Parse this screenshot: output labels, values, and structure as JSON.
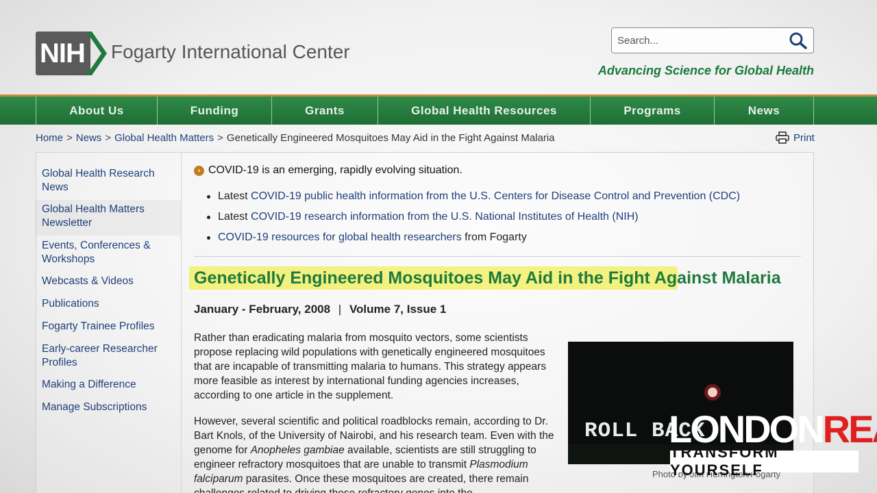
{
  "header": {
    "logo_text": "NIH",
    "org_name": "Fogarty International Center",
    "tagline": "Advancing Science for Global Health",
    "search_placeholder": "Search..."
  },
  "nav": {
    "items": [
      {
        "label": "About Us"
      },
      {
        "label": "Funding"
      },
      {
        "label": "Grants"
      },
      {
        "label": "Global Health Resources"
      },
      {
        "label": "Programs"
      },
      {
        "label": "News"
      }
    ]
  },
  "breadcrumb": {
    "home": "Home",
    "news": "News",
    "section": "Global Health Matters",
    "current": "Genetically Engineered Mosquitoes May Aid in the Fight Against Malaria",
    "separator": ">"
  },
  "print_label": "Print",
  "sidebar": {
    "items": [
      {
        "label": "Global Health Research News"
      },
      {
        "label": "Global Health Matters Newsletter"
      },
      {
        "label": "Events, Conferences & Workshops"
      },
      {
        "label": "Webcasts & Videos"
      },
      {
        "label": "Publications"
      },
      {
        "label": "Fogarty Trainee Profiles"
      },
      {
        "label": "Early-career Researcher Profiles"
      },
      {
        "label": "Making a Difference"
      },
      {
        "label": "Manage Subscriptions"
      }
    ]
  },
  "alert": {
    "text": "COVID-19 is an emerging, rapidly evolving situation.",
    "bullets": [
      {
        "prefix": "Latest ",
        "link": "COVID-19 public health information from the U.S. Centers for Disease Control and Prevention (CDC)",
        "suffix": ""
      },
      {
        "prefix": "Latest ",
        "link": "COVID-19 research information from the U.S. National Institutes of Health (NIH)",
        "suffix": ""
      },
      {
        "prefix": "",
        "link": "COVID-19 resources for global health researchers",
        "suffix": " from Fogarty"
      }
    ]
  },
  "article": {
    "title": "Genetically Engineered Mosquitoes May Aid in the Fight Against Malaria",
    "date": "January - February, 2008",
    "date_separator": "|",
    "volume": "Volume 7, Issue 1",
    "para1": "Rather than eradicating malaria from mosquito vectors, some scientists propose replacing wild populations with genetically engineered mosquitoes that are incapable of transmitting malaria to humans. This strategy appears more feasible as interest by international funding agencies increases, according to one article in the supplement.",
    "para2_a": "However, several scientific and political roadblocks remain, according to Dr. Bart Knols, of the University of Nairobi, and his research team. Even with the genome for ",
    "para2_species1": "Anopheles gambiae",
    "para2_b": " available, scientists are still struggling to engineer refractory mosquitoes that are unable to transmit ",
    "para2_species2": "Plasmodium falciparum",
    "para2_c": " parasites. Once these mosquitoes are created, there remain challenges related to driving these refractory genes into the",
    "photo_text": "ROLL BACK",
    "photo_caption": "Photo by Jim Herrington/Fogarty"
  },
  "watermark": {
    "line1_white": "LONDON",
    "line1_red": "REAL",
    "line2": "TRANSFORM YOURSELF"
  },
  "colors": {
    "nav_green": "#2f8a47",
    "accent_orange": "#c88b3c",
    "headline_green": "#1f7a3d",
    "link_blue": "#1f3f7a",
    "highlight_yellow": "#f2f06a",
    "brand_red": "#e0201e"
  }
}
